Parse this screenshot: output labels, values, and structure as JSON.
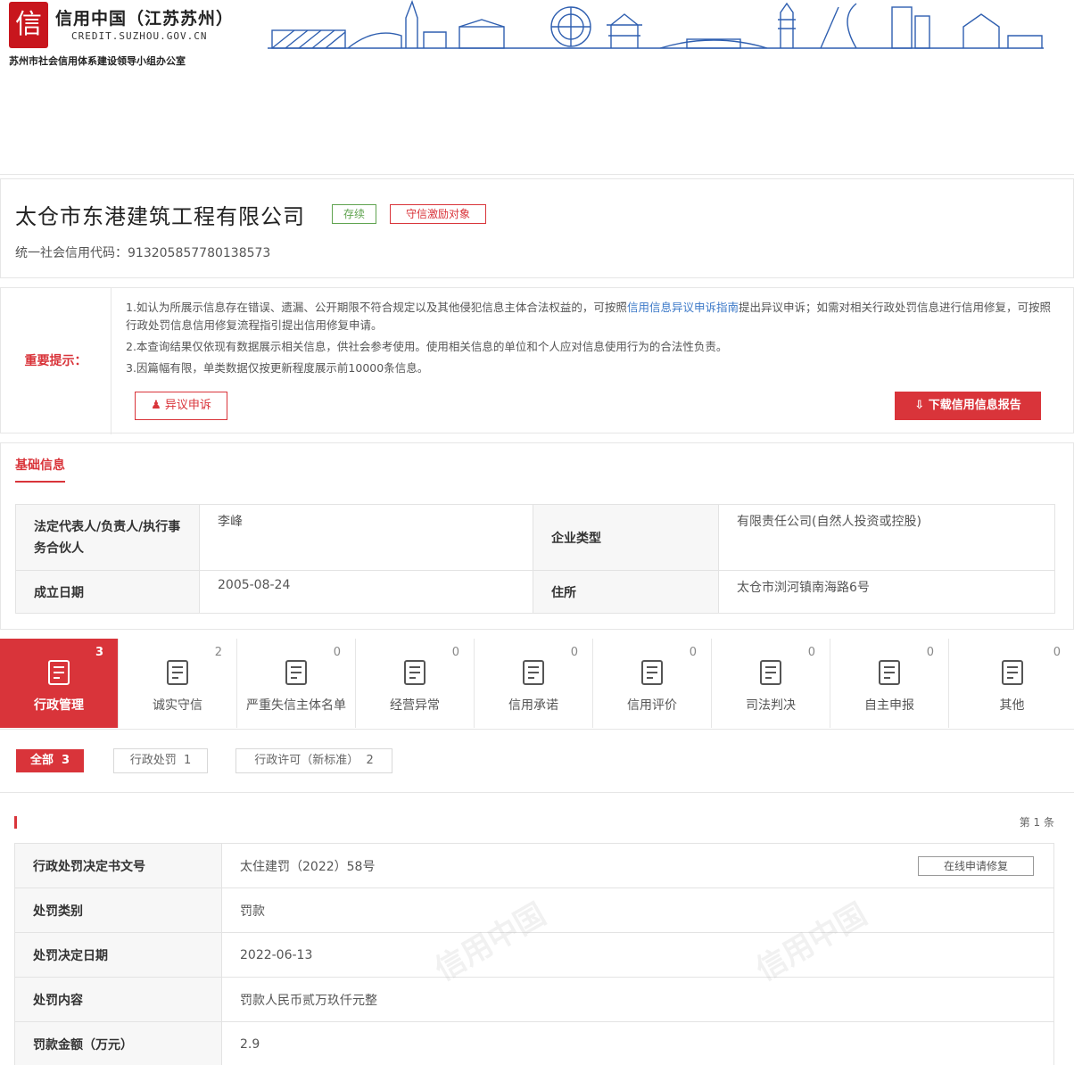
{
  "header": {
    "logo_char": "信",
    "title": "信用中国（江苏苏州）",
    "url": "CREDIT.SUZHOU.GOV.CN",
    "office": "苏州市社会信用体系建设领导小组办公室"
  },
  "company": {
    "name": "太仓市东港建筑工程有限公司",
    "status_tag": "存续",
    "object_tag": "守信激励对象",
    "credit_code_label": "统一社会信用代码：",
    "credit_code": "913205857780138573"
  },
  "notice": {
    "label": "重要提示：",
    "line1_a": "1.如认为所展示信息存在错误、遗漏、公开期限不符合规定以及其他侵犯信息主体合法权益的，可按照",
    "line1_link": "信用信息异议申诉指南",
    "line1_b": "提出异议申诉；如需对相关行政处罚信息进行信用修复，可按照行政处罚信息信用修复流程指引提出信用修复申请。",
    "line2": "2.本查询结果仅依现有数据展示相关信息，供社会参考使用。使用相关信息的单位和个人应对信息使用行为的合法性负责。",
    "line3": "3.因篇幅有限，单类数据仅按更新程度展示前10000条信息。",
    "objection_button": "异议申诉",
    "download_button": "下载信用信息报告"
  },
  "basic": {
    "title": "基础信息",
    "rows": [
      {
        "k1": "法定代表人/负责人/执行事务合伙人",
        "v1": "李峰",
        "k2": "企业类型",
        "v2": "有限责任公司(自然人投资或控股)"
      },
      {
        "k1": "成立日期",
        "v1": "2005-08-24",
        "k2": "住所",
        "v2": "太仓市浏河镇南海路6号"
      }
    ]
  },
  "categories": [
    {
      "label": "行政管理",
      "count": "3",
      "icon": "document-stamp-icon"
    },
    {
      "label": "诚实守信",
      "count": "2",
      "icon": "shield-icon"
    },
    {
      "label": "严重失信主体名单",
      "count": "0",
      "icon": "printer-icon"
    },
    {
      "label": "经营异常",
      "count": "0",
      "icon": "alarm-light-icon"
    },
    {
      "label": "信用承诺",
      "count": "0",
      "icon": "promise-doc-icon"
    },
    {
      "label": "信用评价",
      "count": "0",
      "icon": "evaluation-icon"
    },
    {
      "label": "司法判决",
      "count": "0",
      "icon": "judgment-icon"
    },
    {
      "label": "自主申报",
      "count": "0",
      "icon": "self-declare-icon"
    },
    {
      "label": "其他",
      "count": "0",
      "icon": "other-icon"
    }
  ],
  "filters": {
    "all": "全部",
    "all_count": "3",
    "f1": "行政处罚",
    "f1_count": "1",
    "f2": "行政许可（新标准）",
    "f2_count": "2"
  },
  "record": {
    "page_text": "第 1 条",
    "repair_button": "在线申请修复",
    "rows": [
      {
        "k": "行政处罚决定书文号",
        "v": "太住建罚（2022）58号"
      },
      {
        "k": "处罚类别",
        "v": "罚款"
      },
      {
        "k": "处罚决定日期",
        "v": "2022-06-13"
      },
      {
        "k": "处罚内容",
        "v": "罚款人民币贰万玖仟元整"
      },
      {
        "k": "罚款金额（万元）",
        "v": "2.9"
      }
    ],
    "watermark": "信用中国"
  }
}
